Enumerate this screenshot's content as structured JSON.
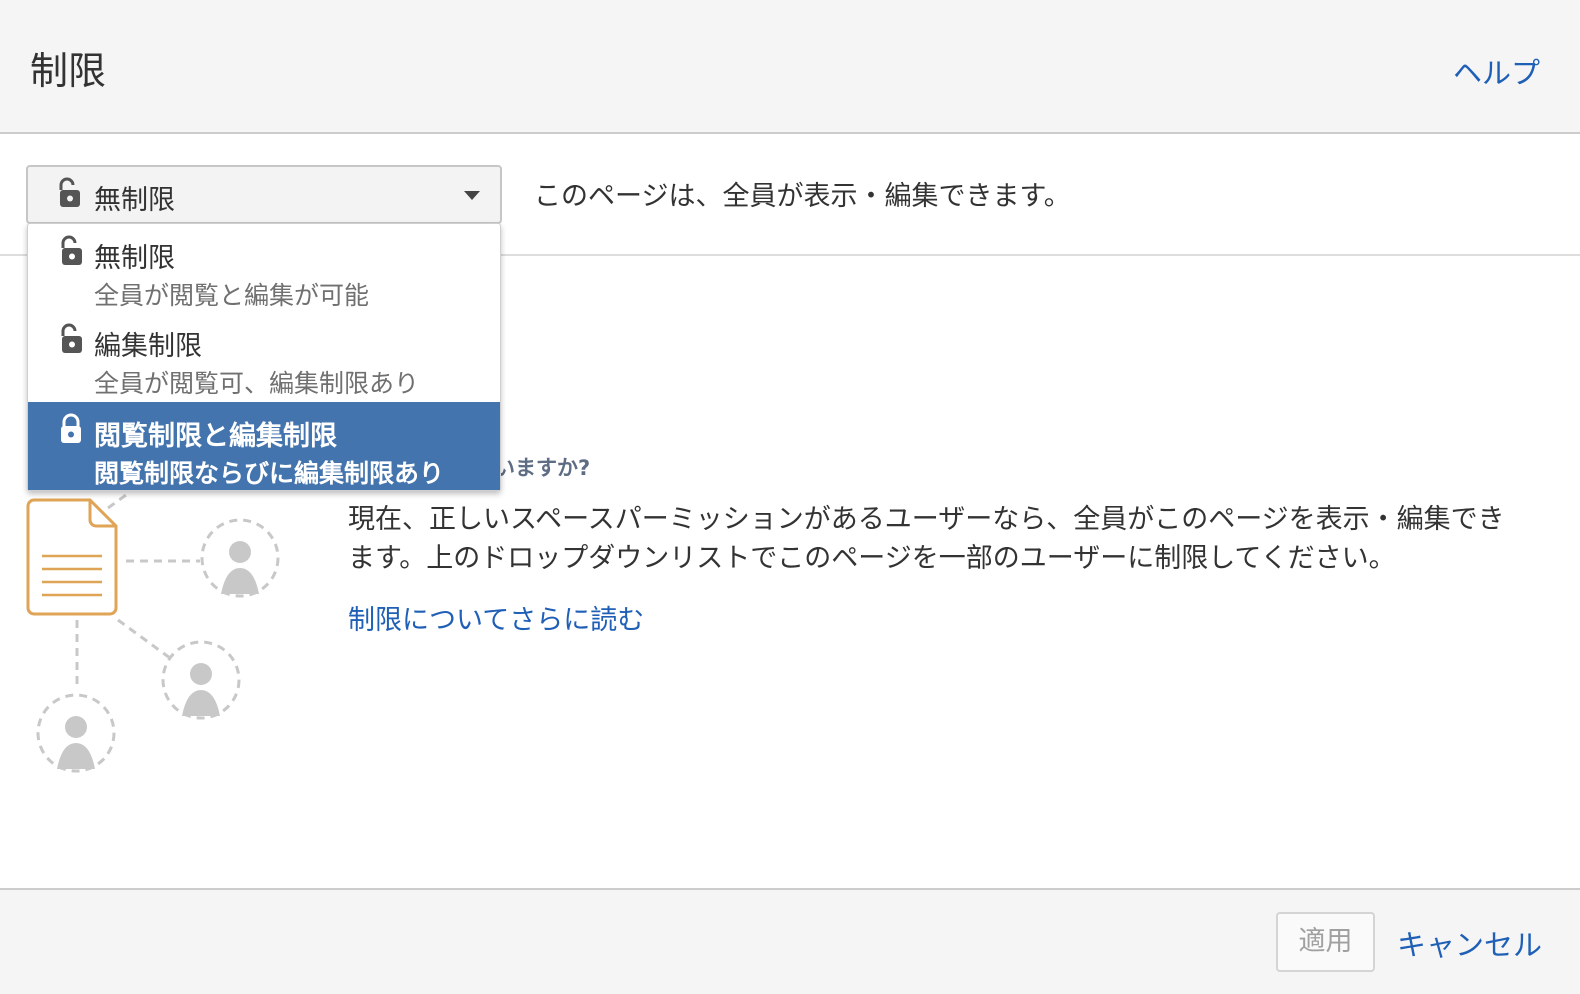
{
  "header": {
    "title": "制限",
    "help_label": "ヘルプ"
  },
  "restriction_select": {
    "selected_label": "無制限",
    "status_text": "このページは、全員が表示・編集できます。"
  },
  "dropdown": {
    "options": [
      {
        "label": "無制限",
        "description": "全員が閲覧と編集が可能",
        "icon": "unlocked-icon"
      },
      {
        "label": "編集制限",
        "description": "全員が閲覧可、編集制限あり",
        "icon": "unlocked-icon"
      },
      {
        "label": "閲覧制限と編集制限",
        "description": "閲覧制限ならびに編集制限あり",
        "icon": "locked-icon"
      }
    ],
    "highlighted_index": 2
  },
  "info": {
    "question_visible": "扱っていますか?",
    "description": "現在、正しいスペースパーミッションがあるユーザーなら、全員がこのページを表示・編集できます。上のドロップダウンリストでこのページを一部のユーザーに制限してください。",
    "read_more_label": "制限についてさらに読む"
  },
  "footer": {
    "apply_label": "適用",
    "cancel_label": "キャンセル"
  },
  "colors": {
    "link": "#1f5fb6",
    "selected_bg": "#4474ad",
    "document_accent": "#e0a456",
    "user_placeholder": "#c8c8c8"
  }
}
